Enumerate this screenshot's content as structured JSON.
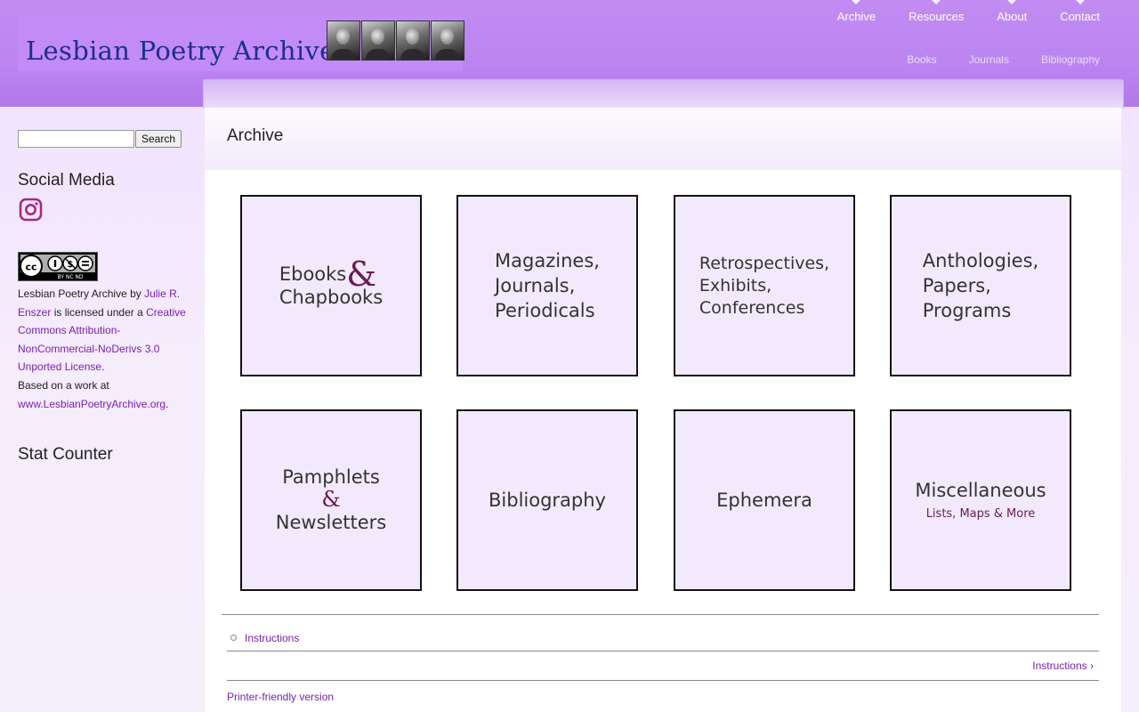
{
  "site": {
    "title": "Lesbian Poetry Archive",
    "portraits": [
      "portrait-1",
      "portrait-2",
      "portrait-3",
      "portrait-4"
    ]
  },
  "nav": {
    "primary": [
      "Archive",
      "Resources",
      "About",
      "Contact"
    ],
    "secondary": [
      "Books",
      "Journals",
      "Bibliography"
    ]
  },
  "sidebar": {
    "search_button": "Search",
    "search_value": "",
    "social_title": "Social Media",
    "social_icon": "instagram-icon",
    "cc_badge_text": "BY NC ND",
    "license": {
      "part1": "Lesbian Poetry Archive by ",
      "author": "Julie R. Enszer",
      "part2": " is licensed under a ",
      "license_name": "Creative Commons Attribution-NonCommercial-NoDerivs 3.0 Unported License",
      "part3": ".",
      "based_on": "Based on a work at ",
      "site_link": "www.LesbianPoetryArchive.org",
      "end": "."
    },
    "stat_title": "Stat Counter"
  },
  "main": {
    "title": "Archive",
    "tiles": [
      {
        "line1": "Ebooks",
        "amp": "&",
        "line2": "Chapbooks"
      },
      {
        "lines": [
          "Magazines,",
          "Journals,",
          "Periodicals"
        ]
      },
      {
        "lines": [
          "Retrospectives,",
          "Exhibits,",
          "Conferences"
        ]
      },
      {
        "lines": [
          "Anthologies,",
          "Papers,",
          "Programs"
        ]
      },
      {
        "line1": "Pamphlets",
        "amp": "&",
        "line2": "Newsletters"
      },
      {
        "text": "Bibliography"
      },
      {
        "text": "Ephemera"
      },
      {
        "text": "Miscellaneous",
        "sub": "Lists, Maps & More"
      }
    ],
    "book_nav": {
      "child": "Instructions",
      "next": "Instructions ›"
    },
    "printer_link": "Printer-friendly version"
  },
  "colors": {
    "header": "#bb84f0",
    "link": "#7a1fb0",
    "tile_bg": "#f2eafc",
    "accent_amp": "#6a1b54"
  }
}
